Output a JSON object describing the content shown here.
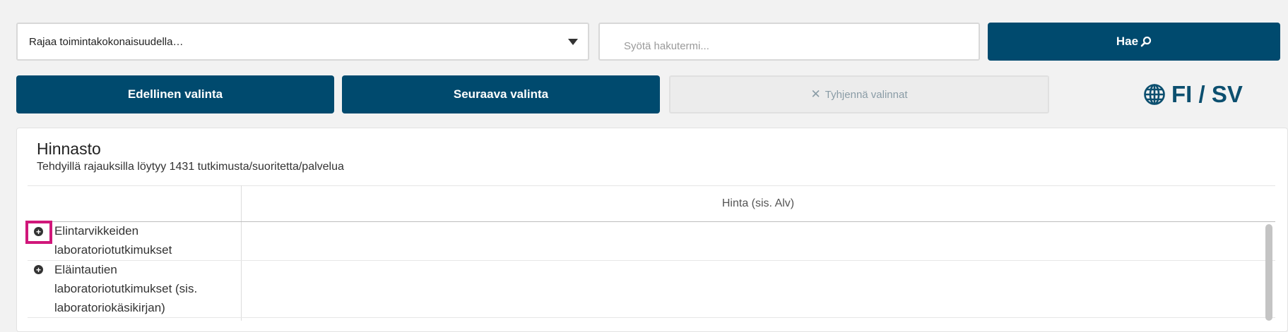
{
  "filter": {
    "select_value": "Rajaa toimintakokonaisuudella…"
  },
  "search": {
    "placeholder": "Syötä hakutermi...",
    "button_label": "Hae"
  },
  "nav": {
    "prev_label": "Edellinen valinta",
    "next_label": "Seuraava valinta",
    "clear_label": "Tyhjennä valinnat"
  },
  "lang": {
    "label": "FI / SV"
  },
  "panel": {
    "title": "Hinnasto",
    "subtitle": "Tehdyillä rajauksilla löytyy 1431 tutkimusta/suoritetta/palvelua",
    "column_header": "Hinta (sis. Alv)",
    "rows": [
      {
        "lines": [
          "Elintarvikkeiden",
          "laboratoriotutkimukset"
        ]
      },
      {
        "lines": [
          "Eläintautien",
          "laboratoriotutkimukset (sis.",
          "laboratoriokäsikirjan)"
        ]
      }
    ]
  },
  "colors": {
    "primary": "#004a6e",
    "highlight": "#d0177a"
  }
}
